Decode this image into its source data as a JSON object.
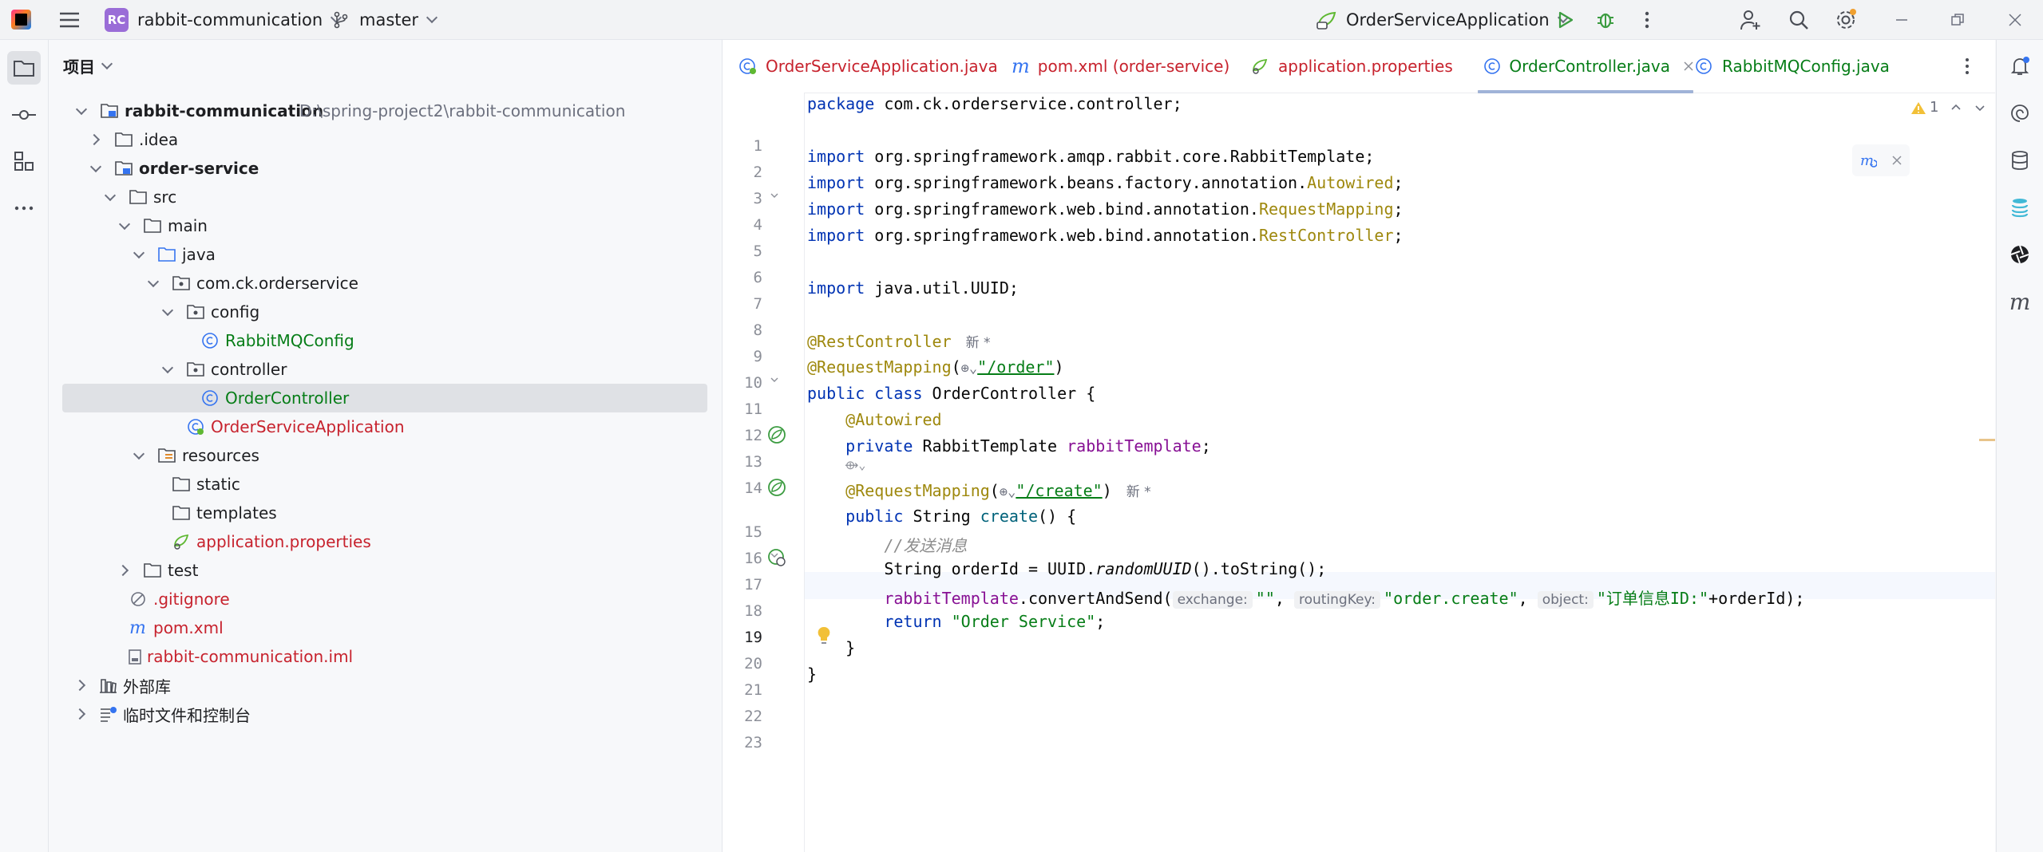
{
  "titlebar": {
    "project_badge": "RC",
    "project_name": "rabbit-communication",
    "branch": "master",
    "run_config": "OrderServiceApplication"
  },
  "project_panel": {
    "header": "项目",
    "tree": [
      {
        "label": "rabbit-communication",
        "path": "D:\\spring-project2\\rabbit-communication"
      },
      {
        "label": ".idea"
      },
      {
        "label": "order-service"
      },
      {
        "label": "src"
      },
      {
        "label": "main"
      },
      {
        "label": "java"
      },
      {
        "label": "com.ck.orderservice"
      },
      {
        "label": "config"
      },
      {
        "label": "RabbitMQConfig"
      },
      {
        "label": "controller"
      },
      {
        "label": "OrderController"
      },
      {
        "label": "OrderServiceApplication"
      },
      {
        "label": "resources"
      },
      {
        "label": "static"
      },
      {
        "label": "templates"
      },
      {
        "label": "application.properties"
      },
      {
        "label": "test"
      },
      {
        "label": ".gitignore"
      },
      {
        "label": "pom.xml"
      },
      {
        "label": "rabbit-communication.iml"
      },
      {
        "label": "外部库"
      },
      {
        "label": "临时文件和控制台"
      }
    ]
  },
  "editor": {
    "tabs": [
      {
        "label": "OrderServiceApplication.java"
      },
      {
        "label": "pom.xml (order-service)"
      },
      {
        "label": "application.properties"
      },
      {
        "label": "OrderController.java"
      },
      {
        "label": "RabbitMQConfig.java"
      }
    ],
    "warning_count": "1",
    "line_numbers": [
      "1",
      "2",
      "3",
      "4",
      "5",
      "6",
      "7",
      "8",
      "9",
      "10",
      "11",
      "12",
      "13",
      "14",
      "15",
      "16",
      "17",
      "18",
      "19",
      "20",
      "21",
      "22",
      "23"
    ],
    "code": {
      "l1_kw": "package",
      "l1_rest": " com.ck.orderservice.controller;",
      "import_kw": "import",
      "l3_rest": " org.springframework.amqp.rabbit.core.RabbitTemplate;",
      "l4_pre": " org.springframework.beans.factory.annotation.",
      "l4_ann": "Autowired",
      "l5_pre": " org.springframework.web.bind.annotation.",
      "l5_ann": "RequestMapping",
      "l6_pre": " org.springframework.web.bind.annotation.",
      "l6_ann": "RestController",
      "semicolon": ";",
      "l8_rest": " java.util.UUID;",
      "l10_ann": "@RestController",
      "new_hint": "新 *",
      "l11_ann": "@RequestMapping",
      "paren_open": "(",
      "l11_str": "\"/order\"",
      "paren_close": ")",
      "l12_kw": "public class",
      "l12_rest": " OrderController {",
      "l13_ann": "@Autowired",
      "l14_kw": "private",
      "l14_type": " RabbitTemplate ",
      "l14_field": "rabbitTemplate",
      "l15_ann": "@RequestMapping",
      "l15_str": "\"/create\"",
      "l16_kw": "public",
      "l16_type": " String ",
      "l16_method": "create",
      "l16_rest": "() {",
      "l17_comment": "//发送消息",
      "l18_pre": "String orderId = UUID.",
      "l18_method": "randomUUID",
      "l18_rest": "().toString();",
      "l19_field": "rabbitTemplate",
      "l19_call": ".convertAndSend(",
      "hint_exchange": "exchange:",
      "l19_str1": "\"\"",
      "comma": ", ",
      "hint_routing": "routingKey:",
      "l19_str2": "\"order.create\"",
      "hint_object": "object:",
      "l19_str3": "\"订单信息ID:\"",
      "l19_rest": "+orderId);",
      "l20_kw": "return",
      "l20_str": "\"Order Service\"",
      "l21": "}",
      "l22": "}"
    }
  }
}
